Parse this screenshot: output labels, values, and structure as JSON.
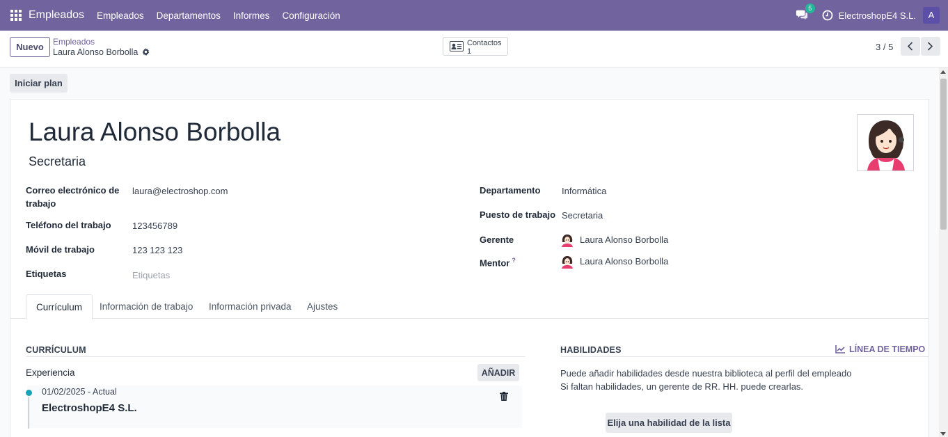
{
  "topbar": {
    "brand": "Empleados",
    "menu": [
      "Empleados",
      "Departamentos",
      "Informes",
      "Configuración"
    ],
    "message_count": "5",
    "company": "ElectroshopE4 S.L.",
    "user_initial": "A"
  },
  "control_panel": {
    "new_label": "Nuevo",
    "breadcrumb_parent": "Empleados",
    "breadcrumb_current": "Laura Alonso Borbolla",
    "contacts_label": "Contactos",
    "contacts_count": "1",
    "pager": "3 / 5"
  },
  "statusbar": {
    "plan_label": "Iniciar plan"
  },
  "employee": {
    "name": "Laura Alonso Borbolla",
    "job_title": "Secretaria",
    "left_fields": [
      {
        "label": "Correo electrónico de trabajo",
        "value": "laura@electroshop.com"
      },
      {
        "label": "Teléfono del trabajo",
        "value": "123456789"
      },
      {
        "label": "Móvil de trabajo",
        "value": "123 123 123"
      },
      {
        "label": "Etiquetas",
        "placeholder": "Etiquetas"
      }
    ],
    "right_fields": [
      {
        "label": "Departamento",
        "value": "Informática"
      },
      {
        "label": "Puesto de trabajo",
        "value": "Secretaria"
      },
      {
        "label": "Gerente",
        "value": "Laura Alonso Borbolla"
      },
      {
        "label": "Mentor",
        "value": "Laura Alonso Borbolla",
        "help": "?"
      }
    ]
  },
  "tabs": [
    "Currículum",
    "Información de trabajo",
    "Información privada",
    "Ajustes"
  ],
  "resume": {
    "title": "CURRÍCULUM",
    "section": "Experiencia",
    "add_label": "AÑADIR",
    "lines": [
      {
        "date": "01/02/2025 - Actual",
        "name": "ElectroshopE4 S.L."
      }
    ]
  },
  "skills": {
    "title": "HABILIDADES",
    "timeline_label": "LÍNEA DE TIEMPO",
    "help_line1": "Puede añadir habilidades desde nuestra biblioteca al perfil del empleado",
    "help_line2": "Si faltan habilidades, un gerente de RR. HH. puede crearlas.",
    "pick_label": "Elija una habilidad de la lista"
  },
  "colors": {
    "brand": "#71639e",
    "badge": "#21b799",
    "accent_dot": "#17a2b8"
  }
}
